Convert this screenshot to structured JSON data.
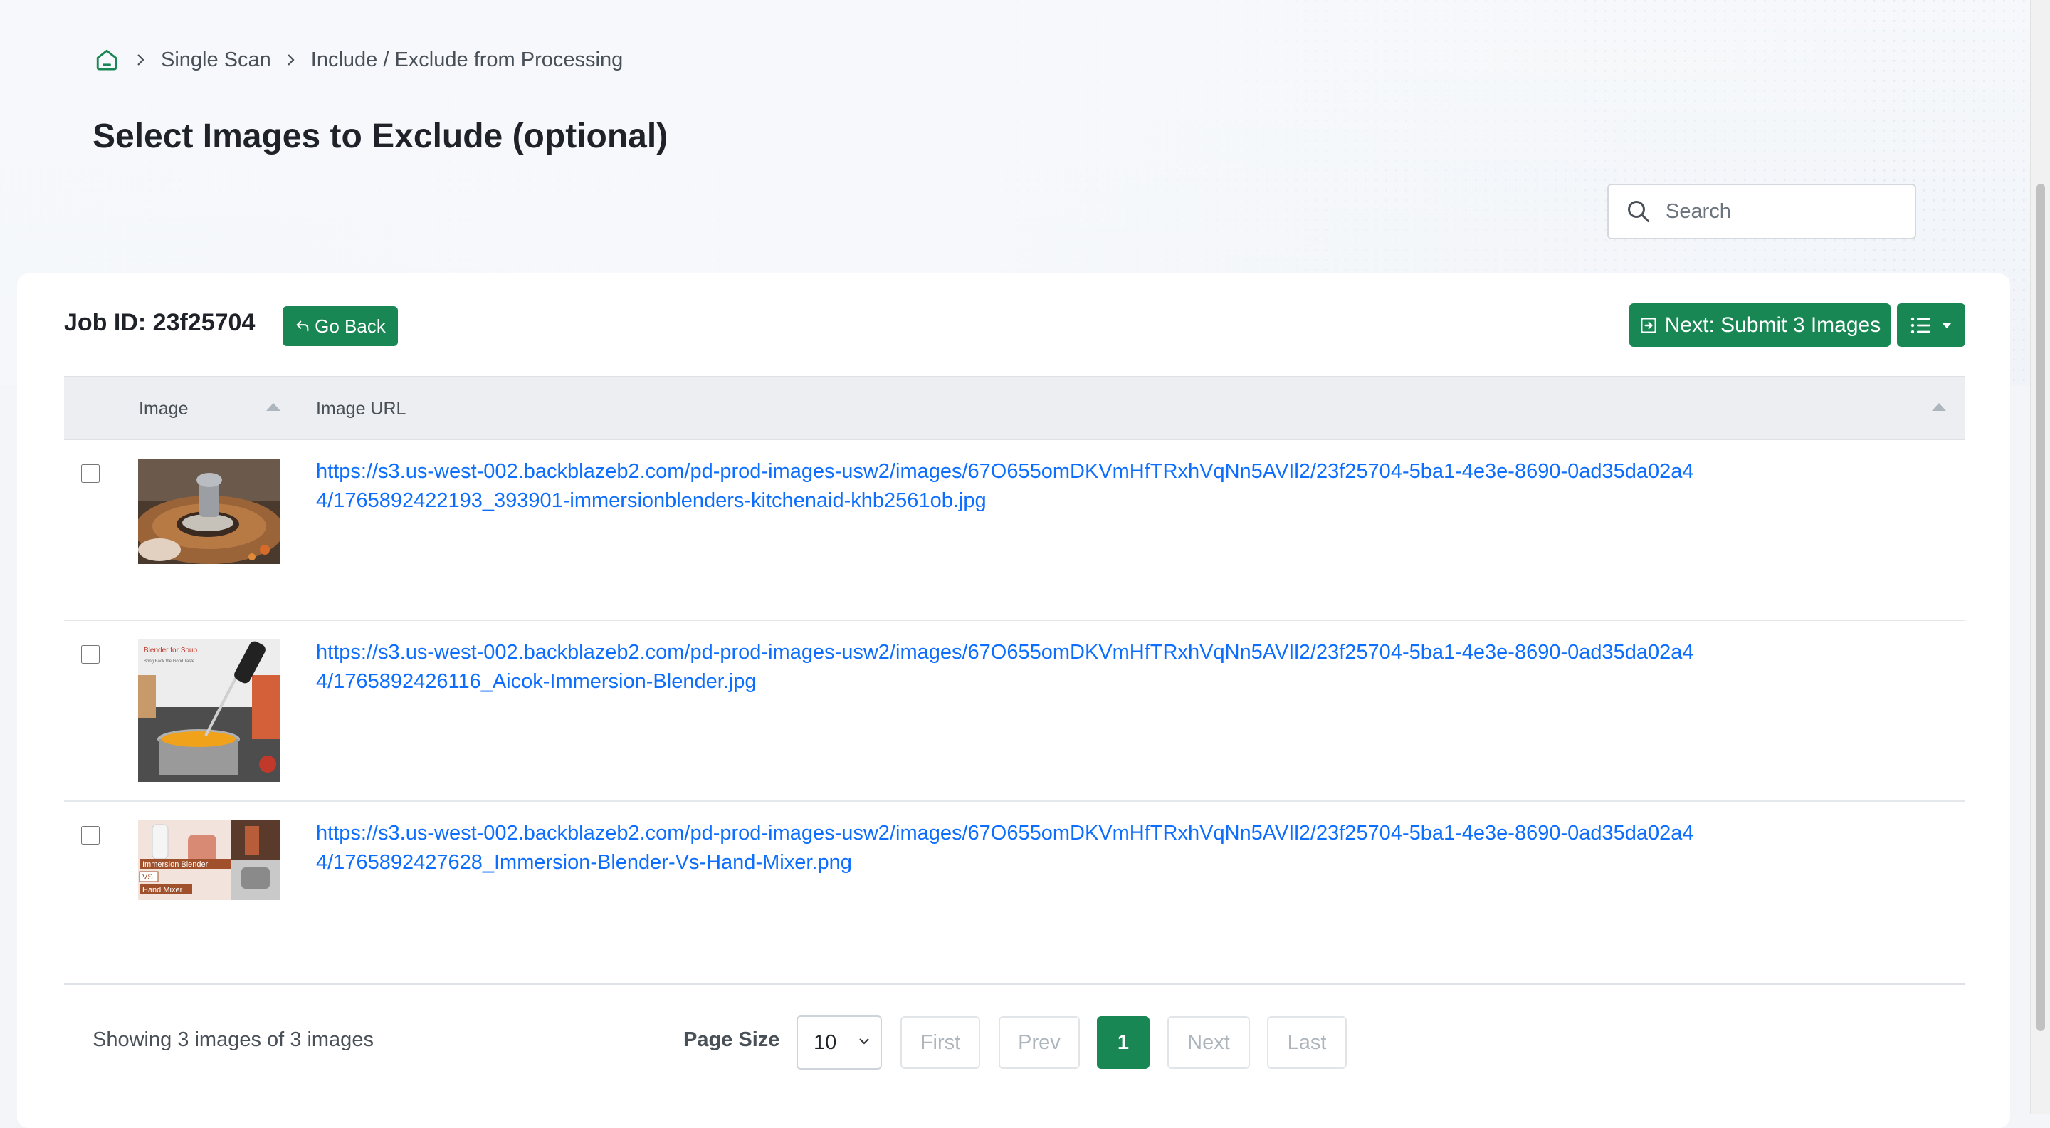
{
  "breadcrumb": {
    "items": [
      "Single Scan",
      "Include / Exclude from Processing"
    ]
  },
  "page": {
    "title": "Select Images to Exclude (optional)"
  },
  "search": {
    "placeholder": "Search"
  },
  "job": {
    "label": "Job ID: 23f25704",
    "go_back_label": "Go Back",
    "next_label": "Next: Submit 3 Images"
  },
  "table": {
    "columns": [
      "Image",
      "Image URL"
    ],
    "rows": [
      {
        "url": "https://s3.us-west-002.backblazeb2.com/pd-prod-images-usw2/images/67O655omDKVmHfTRxhVqNn5AVIl2/23f25704-5ba1-4e3e-8690-0ad35da02a44/1765892422193_393901-immersionblenders-kitchenaid-khb2561ob.jpg"
      },
      {
        "url": "https://s3.us-west-002.backblazeb2.com/pd-prod-images-usw2/images/67O655omDKVmHfTRxhVqNn5AVIl2/23f25704-5ba1-4e3e-8690-0ad35da02a44/1765892426116_Aicok-Immersion-Blender.jpg",
        "thumb_text": [
          "Blender for Soup",
          "Bring Back the Good Taste"
        ]
      },
      {
        "url": "https://s3.us-west-002.backblazeb2.com/pd-prod-images-usw2/images/67O655omDKVmHfTRxhVqNn5AVIl2/23f25704-5ba1-4e3e-8690-0ad35da02a44/1765892427628_Immersion-Blender-Vs-Hand-Mixer.png",
        "thumb_text": [
          "Immersion Blender",
          "VS",
          "Hand Mixer"
        ]
      }
    ]
  },
  "footer": {
    "showing": "Showing 3 images of 3 images",
    "page_size_label": "Page Size",
    "page_size_value": "10",
    "pagination": {
      "first": "First",
      "prev": "Prev",
      "current": "1",
      "next": "Next",
      "last": "Last"
    }
  },
  "colors": {
    "primary_green": "#198754",
    "link_blue": "#0d6efd"
  }
}
